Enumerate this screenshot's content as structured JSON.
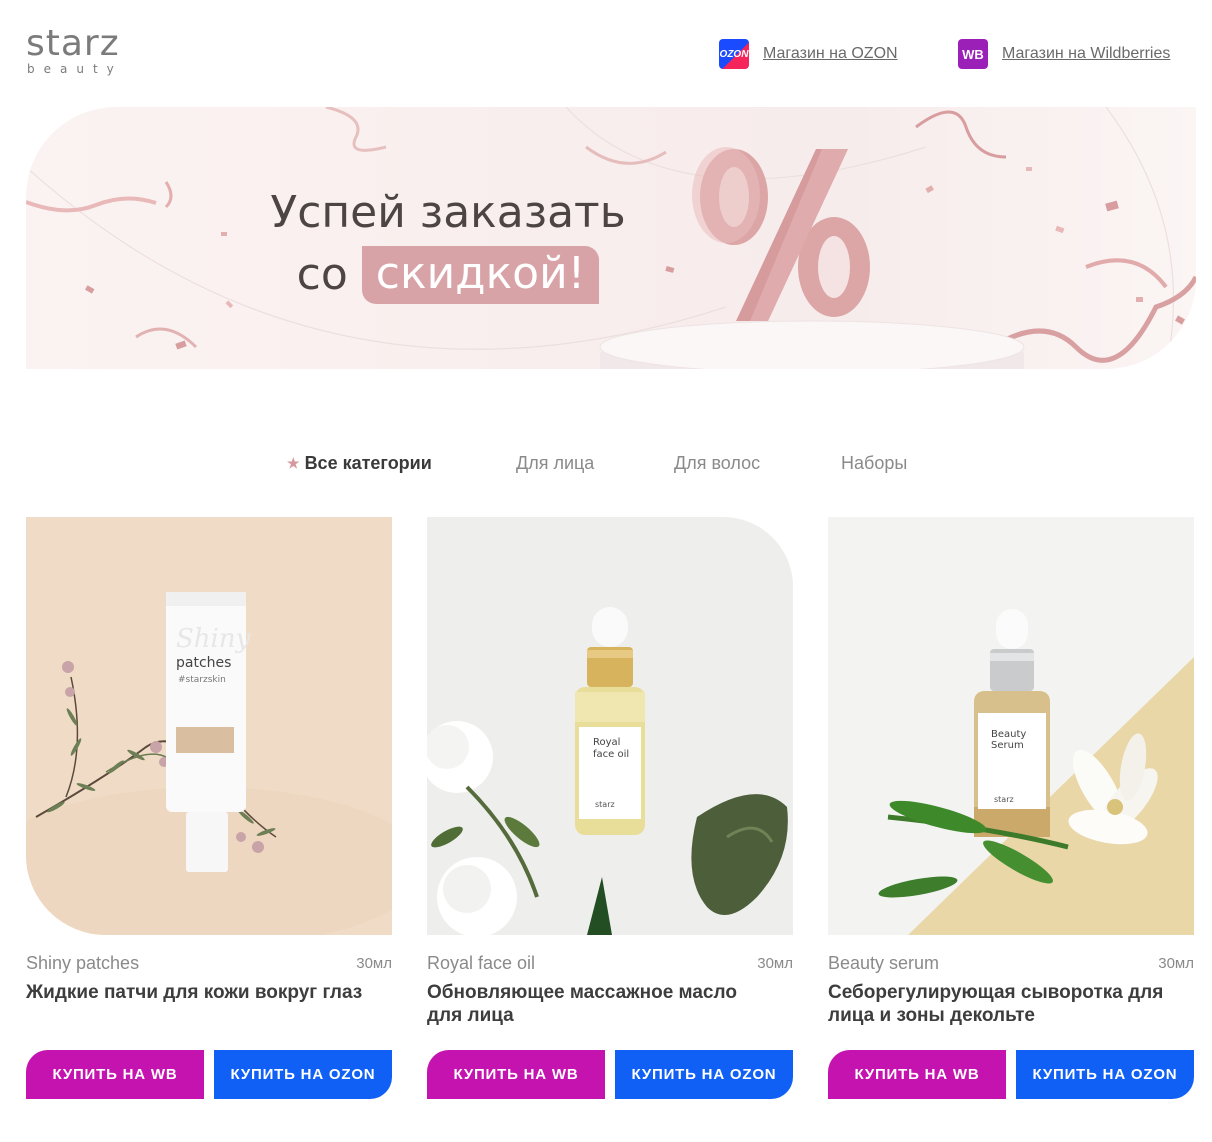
{
  "header": {
    "logo": {
      "main": "starz",
      "sub": "beauty"
    },
    "links": [
      {
        "badge": "OZON",
        "label": "Магазин на OZON",
        "icon": "ozon-icon"
      },
      {
        "badge": "WB",
        "label": "Магазин на Wildberries",
        "icon": "wb-icon"
      }
    ]
  },
  "banner": {
    "line1": "Успей заказать",
    "line2_prefix": "со",
    "line2_highlight": "скидкой!",
    "symbol": "%"
  },
  "tabs": [
    {
      "label": "Все категории",
      "active": true,
      "icon": "star-icon"
    },
    {
      "label": "Для лица",
      "active": false
    },
    {
      "label": "Для волос",
      "active": false
    },
    {
      "label": "Наборы",
      "active": false
    }
  ],
  "products": [
    {
      "name": "Shiny patches",
      "volume": "30мл",
      "description": "Жидкие патчи для кожи вокруг глаз",
      "label_line1": "Shiny",
      "label_line2": "patches",
      "buy_wb": "КУПИТЬ НА WB",
      "buy_ozon": "КУПИТЬ НА OZON"
    },
    {
      "name": "Royal face oil",
      "volume": "30мл",
      "description": "Обновляющее массажное масло для лица",
      "label_line1": "Royal",
      "label_line2": "face oil",
      "buy_wb": "КУПИТЬ НА WB",
      "buy_ozon": "КУПИТЬ НА OZON"
    },
    {
      "name": "Beauty serum",
      "volume": "30мл",
      "description": "Себорегулирующая сыворотка для лица и зоны декольте",
      "label_line1": "Beauty",
      "label_line2": "Serum",
      "buy_wb": "КУПИТЬ НА WB",
      "buy_ozon": "КУПИТЬ НА OZON"
    }
  ],
  "colors": {
    "wb_button": "#c513b0",
    "ozon_button": "#1160f5",
    "accent_pink": "#d8a3a6"
  }
}
